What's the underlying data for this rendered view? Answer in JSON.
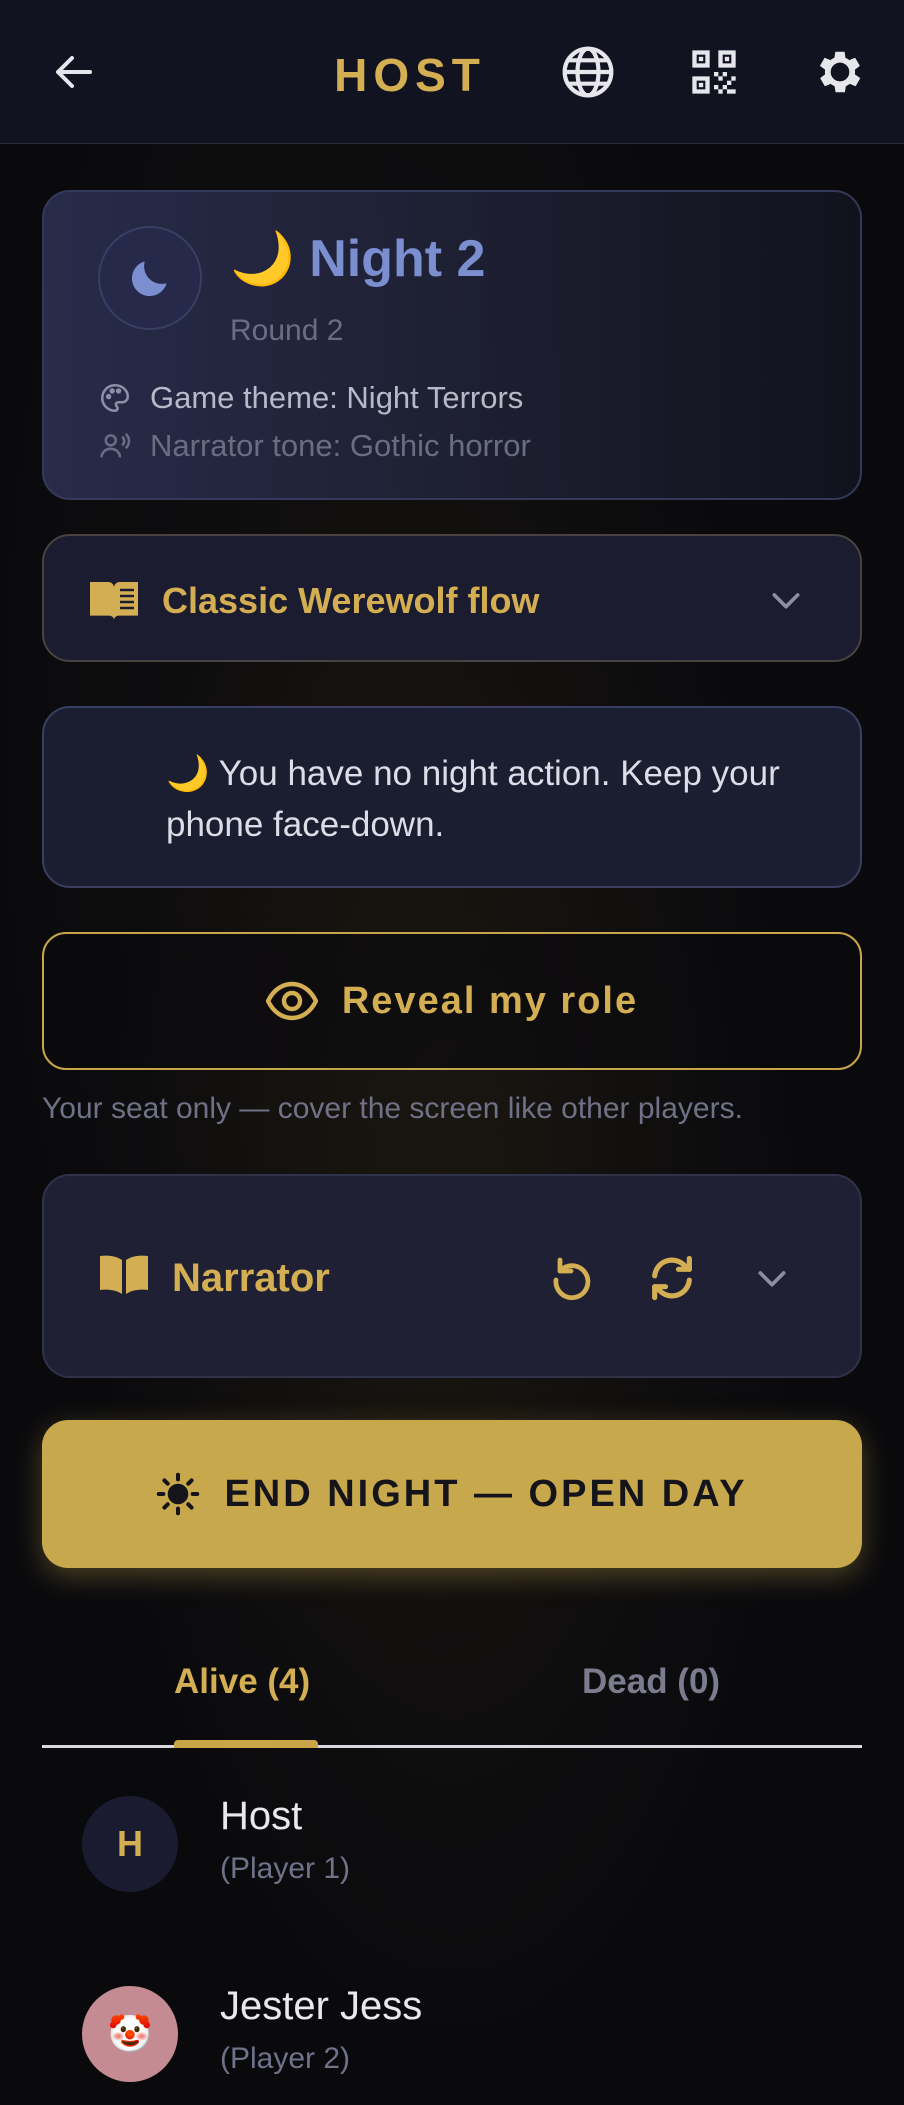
{
  "header": {
    "title": "HOST",
    "back_icon": "arrow-left-icon",
    "language_icon": "globe-icon",
    "qr_icon": "qr-code-icon",
    "settings_icon": "gear-icon"
  },
  "phase_card": {
    "title": "🌙 Night 2",
    "round": "Round 2",
    "theme": "Game theme: Night Terrors",
    "tone": "Narrator tone: Gothic horror"
  },
  "flow_selector": {
    "label": "Classic Werewolf flow"
  },
  "night_action": {
    "text": "🌙 You have no night action. Keep your phone face-down."
  },
  "reveal": {
    "label": "Reveal my role",
    "note": "Your seat only — cover the screen like other players."
  },
  "narrator": {
    "label": "Narrator"
  },
  "end_phase": {
    "label": "END NIGHT — OPEN DAY"
  },
  "tabs": {
    "alive": "Alive (4)",
    "dead": "Dead (0)"
  },
  "players": [
    {
      "initial": "H",
      "name": "Host",
      "seat": "(Player 1)"
    },
    {
      "initial": "🤡",
      "name": "Jester Jess",
      "seat": "(Player 2)"
    }
  ],
  "colors": {
    "accent_gold": "#d4ae52",
    "night_blue": "#7a8ed0",
    "background": "#0a0a0d"
  }
}
